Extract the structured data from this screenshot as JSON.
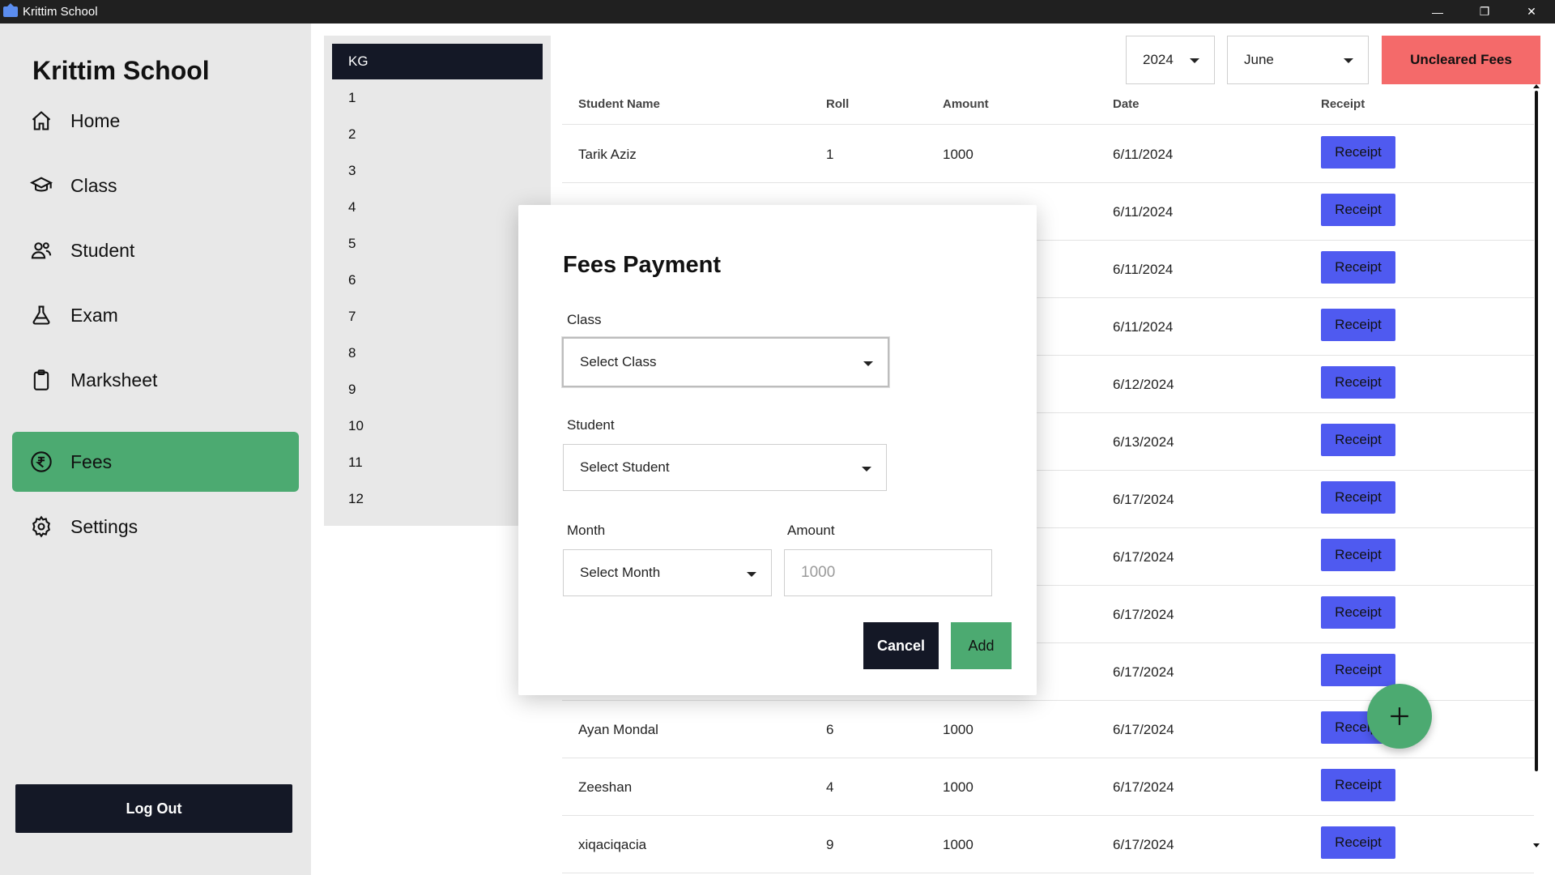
{
  "window": {
    "title": "Krittim School",
    "minimize": "—",
    "restore": "❐",
    "close": "✕"
  },
  "sidebar": {
    "brand": "Krittim School",
    "items": [
      {
        "label": "Home",
        "icon": "home-icon"
      },
      {
        "label": "Class",
        "icon": "graduation-cap-icon"
      },
      {
        "label": "Student",
        "icon": "users-icon"
      },
      {
        "label": "Exam",
        "icon": "flask-icon"
      },
      {
        "label": "Marksheet",
        "icon": "clipboard-icon"
      },
      {
        "label": "Fees",
        "icon": "rupee-icon",
        "active": true
      },
      {
        "label": "Settings",
        "icon": "gear-icon"
      }
    ],
    "logout": "Log Out"
  },
  "classes": [
    "KG",
    "1",
    "2",
    "3",
    "4",
    "5",
    "6",
    "7",
    "8",
    "9",
    "10",
    "11",
    "12"
  ],
  "filters": {
    "year": "2024",
    "month": "June",
    "uncleared": "Uncleared Fees"
  },
  "table": {
    "headers": [
      "Student Name",
      "Roll",
      "Amount",
      "Date",
      "Receipt"
    ],
    "receipt_label": "Receipt",
    "rows": [
      [
        "Tarik Aziz",
        "1",
        "1000",
        "6/11/2024"
      ],
      [
        "",
        "",
        "",
        "6/11/2024"
      ],
      [
        "",
        "",
        "",
        "6/11/2024"
      ],
      [
        "",
        "",
        "",
        "6/11/2024"
      ],
      [
        "",
        "",
        "",
        "6/12/2024"
      ],
      [
        "",
        "",
        "",
        "6/13/2024"
      ],
      [
        "",
        "",
        "",
        "6/17/2024"
      ],
      [
        "",
        "",
        "",
        "6/17/2024"
      ],
      [
        "",
        "",
        "",
        "6/17/2024"
      ],
      [
        "",
        "",
        "",
        "6/17/2024"
      ],
      [
        "Ayan Mondal",
        "6",
        "1000",
        "6/17/2024"
      ],
      [
        "Zeeshan",
        "4",
        "1000",
        "6/17/2024"
      ],
      [
        "xiqaciqacia",
        "9",
        "1000",
        "6/17/2024"
      ]
    ]
  },
  "modal": {
    "title": "Fees Payment",
    "class_label": "Class",
    "class_value": "Select Class",
    "student_label": "Student",
    "student_value": "Select Student",
    "month_label": "Month",
    "month_value": "Select Month",
    "amount_label": "Amount",
    "amount_placeholder": "1000",
    "cancel": "Cancel",
    "add": "Add"
  },
  "colors": {
    "accent_green": "#4caa71",
    "dark": "#141826",
    "receipt_blue": "#4f5af0",
    "danger": "#f46a6a"
  }
}
